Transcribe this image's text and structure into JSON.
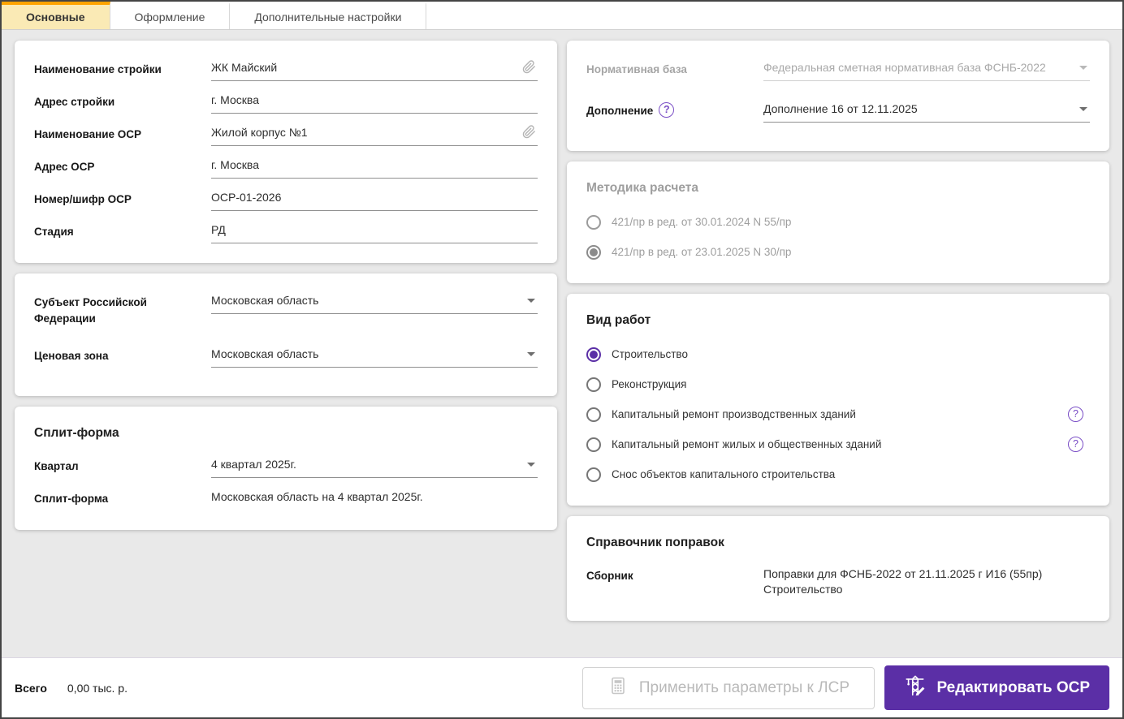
{
  "tabs": [
    {
      "name": "tab-main",
      "label": "Основные",
      "active": true
    },
    {
      "name": "tab-design",
      "label": "Оформление",
      "active": false
    },
    {
      "name": "tab-advanced",
      "label": "Дополнительные настройки",
      "active": false
    }
  ],
  "left": {
    "general": {
      "fields": [
        {
          "label": "Наименование стройки",
          "value": "ЖК Майский",
          "link": true
        },
        {
          "label": "Адрес стройки",
          "value": "г. Москва"
        },
        {
          "label": "Наименование ОСР",
          "value": "Жилой корпус №1",
          "link": true
        },
        {
          "label": "Адрес ОСР",
          "value": "г. Москва"
        },
        {
          "label": "Номер/шифр ОСР",
          "value": "ОСР-01-2026"
        },
        {
          "label": "Стадия",
          "value": "РД"
        }
      ]
    },
    "region": {
      "fields": [
        {
          "label": "Субъект Российской Федерации",
          "value": "Московская область",
          "dropdown": true
        },
        {
          "label": "Ценовая зона",
          "value": "Московская область",
          "dropdown": true
        }
      ]
    },
    "split": {
      "title": "Сплит-форма",
      "fields": [
        {
          "label": "Квартал",
          "value": "4 квартал 2025г.",
          "dropdown": true
        },
        {
          "label": "Сплит-форма",
          "value": "Московская область на 4 квартал 2025г.",
          "readonly": true
        }
      ]
    }
  },
  "right": {
    "base": {
      "fields": [
        {
          "label": "Нормативная база",
          "value": "Федеральная сметная нормативная база ФСНБ-2022",
          "dropdown": true,
          "disabled": true
        },
        {
          "label": "Дополнение",
          "value": "Дополнение 16 от 12.11.2025",
          "dropdown": true,
          "help": true
        }
      ]
    },
    "method": {
      "title": "Методика расчета",
      "disabled": true,
      "options": [
        {
          "label": "421/пр в ред. от 30.01.2024 N 55/пр",
          "selected": false
        },
        {
          "label": "421/пр в ред. от 23.01.2025 N 30/пр",
          "selected": true
        }
      ]
    },
    "worktype": {
      "title": "Вид работ",
      "options": [
        {
          "label": "Строительство",
          "selected": true
        },
        {
          "label": "Реконструкция",
          "selected": false
        },
        {
          "label": "Капитальный ремонт производственных зданий",
          "selected": false,
          "help": true
        },
        {
          "label": "Капитальный ремонт жилых и общественных зданий",
          "selected": false,
          "help": true
        },
        {
          "label": "Снос объектов капитального строительства",
          "selected": false
        }
      ]
    },
    "corrections": {
      "title": "Справочник поправок",
      "fields": [
        {
          "label": "Сборник",
          "value": "Поправки для ФСНБ-2022 от 21.11.2025 г И16 (55пр) Строительство",
          "readonly": true
        }
      ]
    }
  },
  "footer": {
    "total_label": "Всего",
    "total_value": "0,00 тыс. р.",
    "apply_label": "Применить параметры к ЛСР",
    "edit_label": "Редактировать ОСР"
  },
  "icons": {
    "help": "question-mark-circle",
    "attach": "paperclip",
    "dropdown": "caret-down",
    "apply": "calculator",
    "edit": "tower-crane-pencil"
  },
  "colors": {
    "accent": "#5b2fa6",
    "help_icon": "#7b4fc6",
    "tab_active_border": "#ffa300",
    "tab_active_bg": "#faeab5"
  }
}
